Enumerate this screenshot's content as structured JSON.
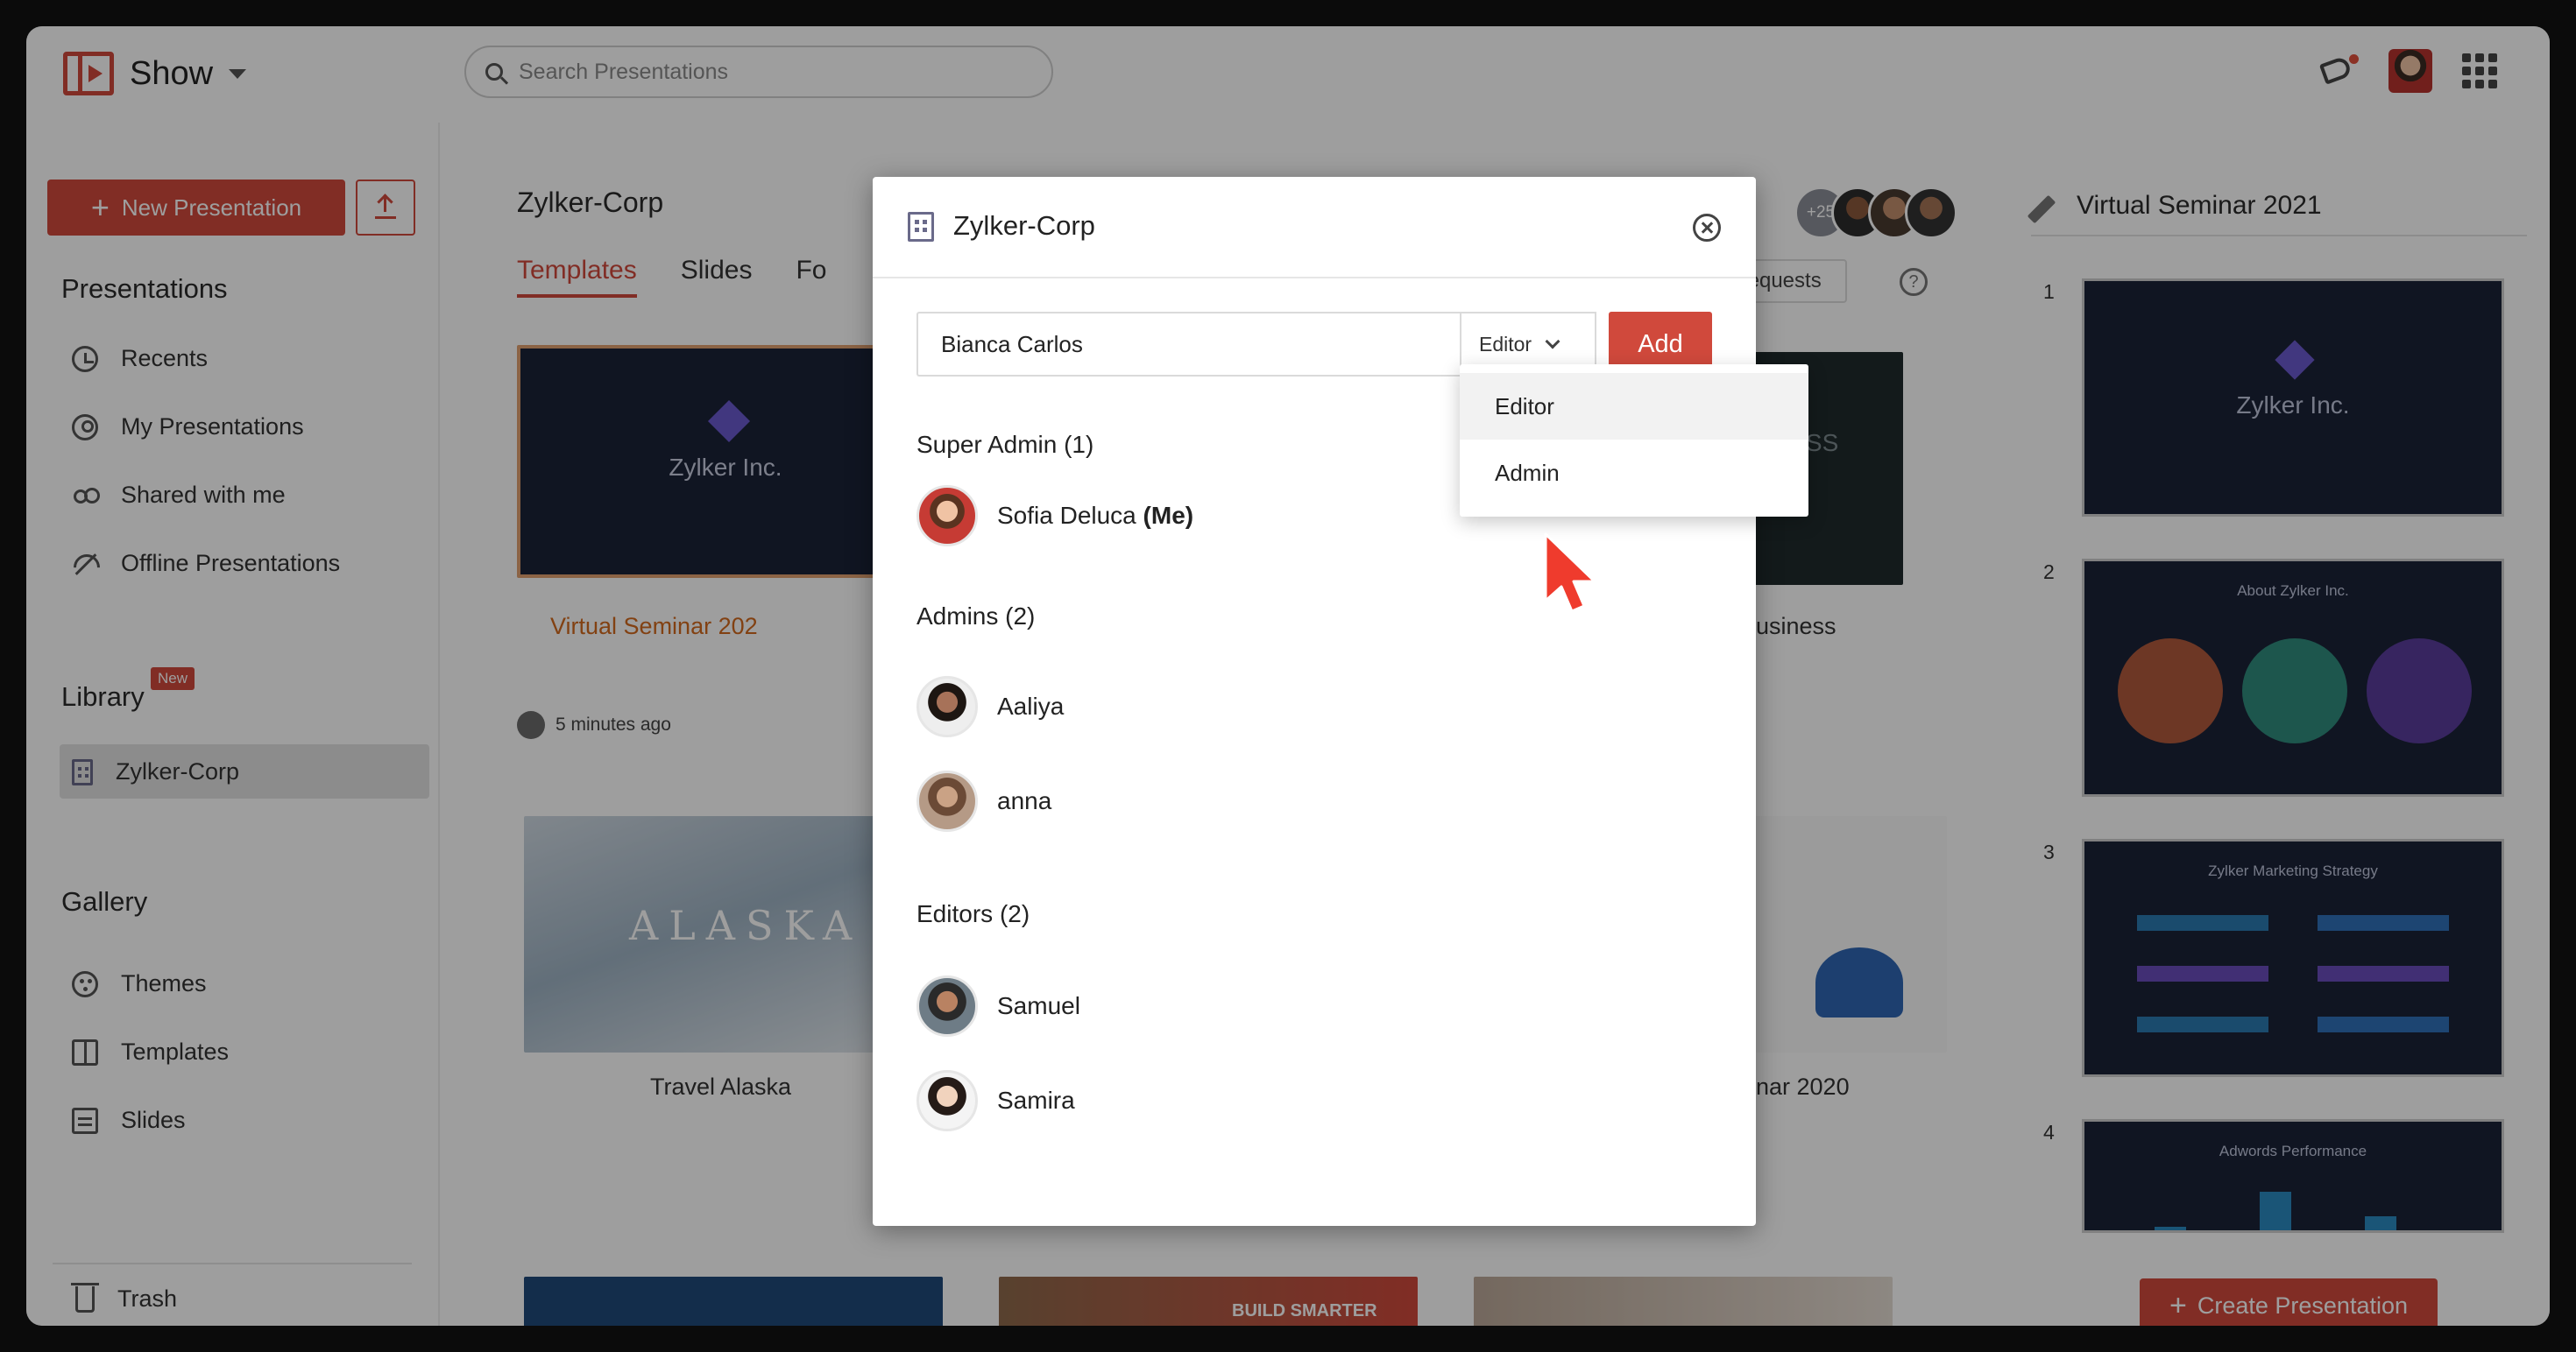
{
  "app": {
    "name": "Show",
    "search_placeholder": "Search Presentations"
  },
  "sidebar": {
    "new_button": "New Presentation",
    "presentations_title": "Presentations",
    "presentations": [
      {
        "label": "Recents",
        "icon": "clock-icon"
      },
      {
        "label": "My Presentations",
        "icon": "user-icon"
      },
      {
        "label": "Shared with me",
        "icon": "shared-users-icon"
      },
      {
        "label": "Offline Presentations",
        "icon": "offline-icon"
      }
    ],
    "library_title": "Library",
    "library_badge": "New",
    "library_items": [
      {
        "label": "Zylker-Corp",
        "icon": "organization-icon",
        "active": true
      }
    ],
    "gallery_title": "Gallery",
    "gallery": [
      {
        "label": "Themes",
        "icon": "palette-icon"
      },
      {
        "label": "Templates",
        "icon": "templates-icon"
      },
      {
        "label": "Slides",
        "icon": "slides-icon"
      }
    ],
    "trash": "Trash"
  },
  "main": {
    "org_title": "Zylker-Corp",
    "tabs": [
      "Templates",
      "Slides",
      "Fo"
    ],
    "collaborators_more": "+25",
    "requests_label": "Requests",
    "help_label": "?",
    "cards": [
      {
        "caption": "Virtual Seminar 202",
        "thumb_title": "Zylker Inc.",
        "meta": "5 minutes ago"
      },
      {
        "caption": "usiness",
        "thumb_title": "NESS"
      },
      {
        "caption": "Travel Alaska",
        "thumb_title": "ALASKA"
      },
      {
        "caption": "nar 2020"
      },
      {
        "thumb_title": "BUILD SMARTER"
      }
    ]
  },
  "right_panel": {
    "title": "Virtual Seminar 2021",
    "slides": [
      {
        "num": "1",
        "title": "Zylker Inc."
      },
      {
        "num": "2",
        "title": "About Zylker Inc."
      },
      {
        "num": "3",
        "title": "Zylker Marketing Strategy"
      },
      {
        "num": "4",
        "title": "Adwords Performance"
      }
    ],
    "create_button": "Create Presentation"
  },
  "modal": {
    "title": "Zylker-Corp",
    "input_value": "Bianca Carlos",
    "role_selected": "Editor",
    "add_button": "Add",
    "groups": {
      "super_admin": {
        "label": "Super Admin",
        "count": "(1)",
        "members": [
          {
            "name": "Sofia Deluca",
            "suffix": "(Me)"
          }
        ]
      },
      "admins": {
        "label": "Admins",
        "count": "(2)",
        "members": [
          {
            "name": "Aaliya"
          },
          {
            "name": "anna"
          }
        ]
      },
      "editors": {
        "label": "Editors",
        "count": "(2)",
        "members": [
          {
            "name": "Samuel"
          },
          {
            "name": "Samira"
          }
        ]
      }
    },
    "role_options": [
      "Editor",
      "Admin"
    ]
  },
  "colors": {
    "accent": "#d0493c",
    "slide_bg": "#1b2238",
    "overlay": "rgba(0,0,0,0.38)"
  }
}
